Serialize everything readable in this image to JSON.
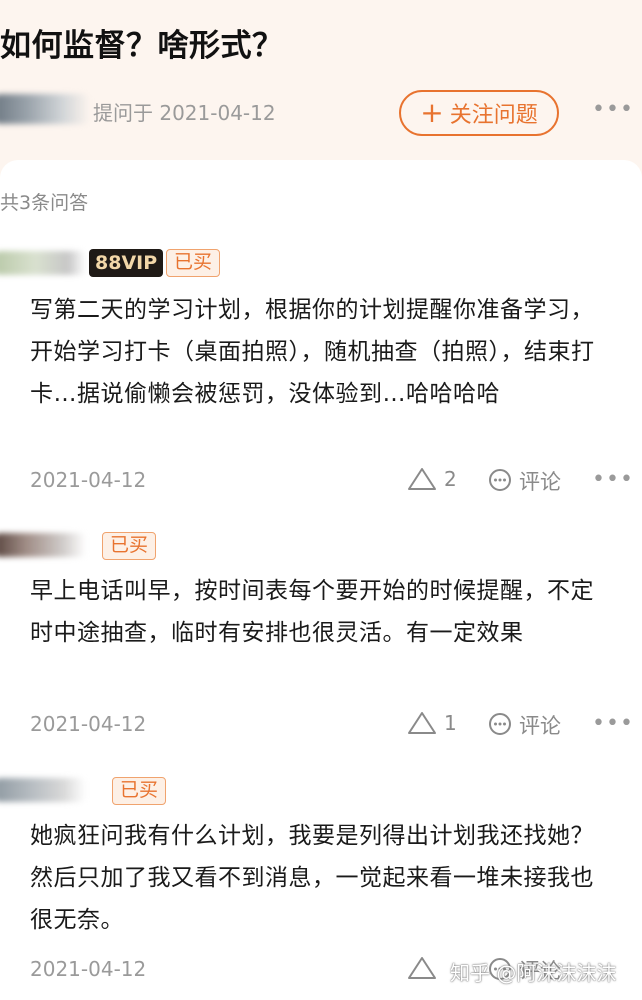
{
  "question": {
    "title": "如何监督？啥形式？",
    "asked_meta": "提问于 2021-04-12",
    "follow_label": "关注问题",
    "follow_icon": "plus-icon",
    "more_icon": "more-dots-icon"
  },
  "answers_count": "共3条问答",
  "answers": [
    {
      "vip_badge": "88VIP",
      "bought_badge": "已买",
      "text": "写第二天的学习计划，根据你的计划提醒你准备学习，开始学习打卡（桌面拍照），随机抽查（拍照），结束打卡…据说偷懒会被惩罚，没体验到…哈哈哈哈",
      "date": "2021-04-12",
      "likes": "2",
      "comment_label": "评论"
    },
    {
      "bought_badge": "已买",
      "text": "早上电话叫早，按时间表每个要开始的时候提醒，不定时中途抽查，临时有安排也很灵活。有一定效果",
      "date": "2021-04-12",
      "likes": "1",
      "comment_label": "评论"
    },
    {
      "bought_badge": "已买",
      "text": "她疯狂问我有什么计划，我要是列得出计划我还找她？然后只加了我又看不到消息，一觉起来看一堆未接我也很无奈。",
      "date": "2021-04-12",
      "comment_label": "评论"
    }
  ],
  "watermark": "知乎 @阿沫沫沫沫",
  "colors": {
    "accent": "#e8732f",
    "header_bg": "#fdf5ef",
    "card_bg": "#ffffff",
    "muted": "#9a9a9a"
  }
}
